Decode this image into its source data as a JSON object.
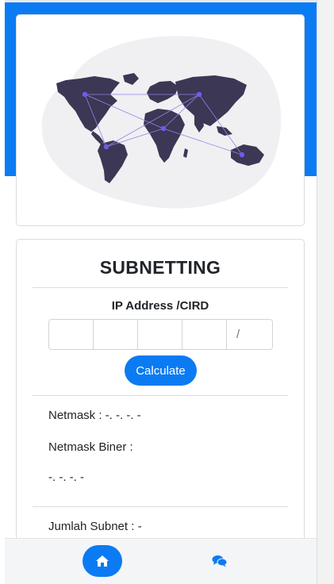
{
  "form": {
    "title": "SUBNETTING",
    "ip_label": "IP Address /CIRD",
    "octet_values": [
      "",
      "",
      "",
      ""
    ],
    "cidr_placeholder": "/",
    "calculate_label": "Calculate"
  },
  "results": {
    "netmask": "Netmask : -. -. -. -",
    "netmask_biner_label": "Netmask Biner :",
    "netmask_biner_value": "-. -. -. -",
    "jumlah_subnet": "Jumlah Subnet : -"
  },
  "nav": {
    "items": [
      "home-icon",
      "comments-icon"
    ],
    "active": "home-icon"
  },
  "colors": {
    "primary": "#0b7bf3",
    "map_land": "#3b3754",
    "map_blob": "#f0f0f2",
    "map_node": "#6b5cf0"
  }
}
